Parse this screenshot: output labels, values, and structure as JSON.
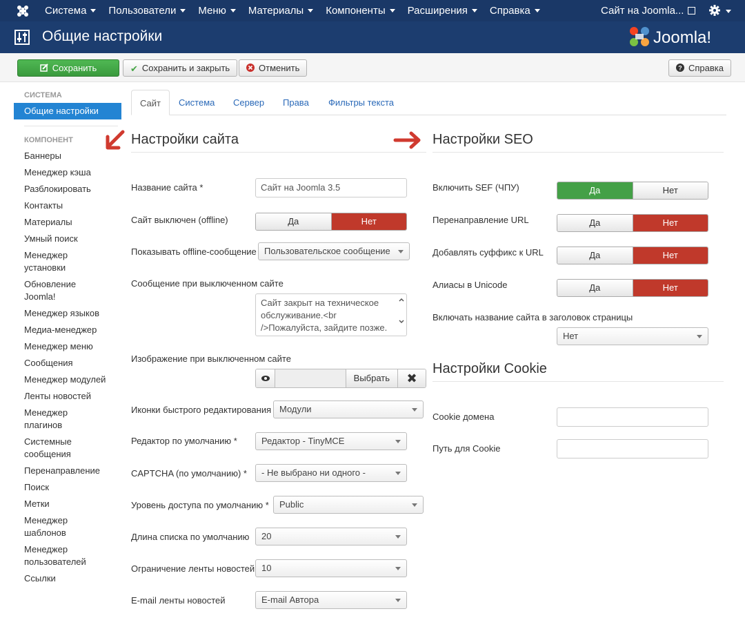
{
  "topnav": {
    "menu": [
      "Система",
      "Пользователи",
      "Меню",
      "Материалы",
      "Компоненты",
      "Расширения",
      "Справка"
    ],
    "site_link": "Сайт на Joomla..."
  },
  "header": {
    "title": "Общие настройки",
    "brand": "Joomla!"
  },
  "toolbar": {
    "save": "Сохранить",
    "save_close": "Сохранить и закрыть",
    "cancel": "Отменить",
    "help": "Справка"
  },
  "sidebar": {
    "system_heading": "Система",
    "active_item": "Общие настройки",
    "component_heading": "Компонент",
    "items": [
      "Баннеры",
      "Менеджер кэша",
      "Разблокировать",
      "Контакты",
      "Материалы",
      "Умный поиск",
      "Менеджер установки",
      "Обновление Joomla!",
      "Менеджер языков",
      "Медиа-менеджер",
      "Менеджер меню",
      "Сообщения",
      "Менеджер модулей",
      "Ленты новостей",
      "Менеджер плагинов",
      "Системные сообщения",
      "Перенаправление",
      "Поиск",
      "Метки",
      "Менеджер шаблонов",
      "Менеджер пользователей",
      "Ссылки"
    ]
  },
  "tabs": [
    "Сайт",
    "Система",
    "Сервер",
    "Права",
    "Фильтры текста"
  ],
  "site_settings": {
    "title": "Настройки сайта",
    "site_name_label": "Название сайта *",
    "site_name_value": "Сайт на Joomla 3.5",
    "offline_label": "Сайт выключен (offline)",
    "yes": "Да",
    "no": "Нет",
    "offline_msg_label": "Показывать offline-сообщение",
    "offline_msg_value": "Пользовательское сообщение",
    "offline_text_label": "Сообщение при выключенном сайте",
    "offline_text_value": "Сайт закрыт на техническое обслуживание.<br />Пожалуйста, зайдите позже.",
    "offline_image_label": "Изображение при выключенном сайте",
    "choose": "Выбрать",
    "frontend_edit_label": "Иконки быстрого редактирования",
    "frontend_edit_value": "Модули",
    "editor_label": "Редактор по умолчанию *",
    "editor_value": "Редактор - TinyMCE",
    "captcha_label": "CAPTCHA (по умолчанию) *",
    "captcha_value": "- Не выбрано ни одного -",
    "access_label": "Уровень доступа по умолчанию *",
    "access_value": "Public",
    "list_limit_label": "Длина списка по умолчанию",
    "list_limit_value": "20",
    "feed_limit_label": "Ограничение ленты новостей",
    "feed_limit_value": "10",
    "feed_email_label": "E-mail ленты новостей",
    "feed_email_value": "E-mail Автора"
  },
  "seo_settings": {
    "title": "Настройки SEO",
    "sef_label": "Включить SEF (ЧПУ)",
    "rewrite_label": "Перенаправление URL",
    "suffix_label": "Добавлять суффикс к URL",
    "unicode_label": "Алиасы в Unicode",
    "sitename_pages_label": "Включать название сайта в заголовок страницы",
    "sitename_pages_value": "Нет"
  },
  "cookie_settings": {
    "title": "Настройки Cookie",
    "domain_label": "Cookie домена",
    "path_label": "Путь для Cookie"
  },
  "colors": {
    "nav": "#1a3867",
    "active": "#2384d3",
    "yes_active": "#44a047",
    "no_active": "#c0392b",
    "arrow": "#d03a2f"
  }
}
